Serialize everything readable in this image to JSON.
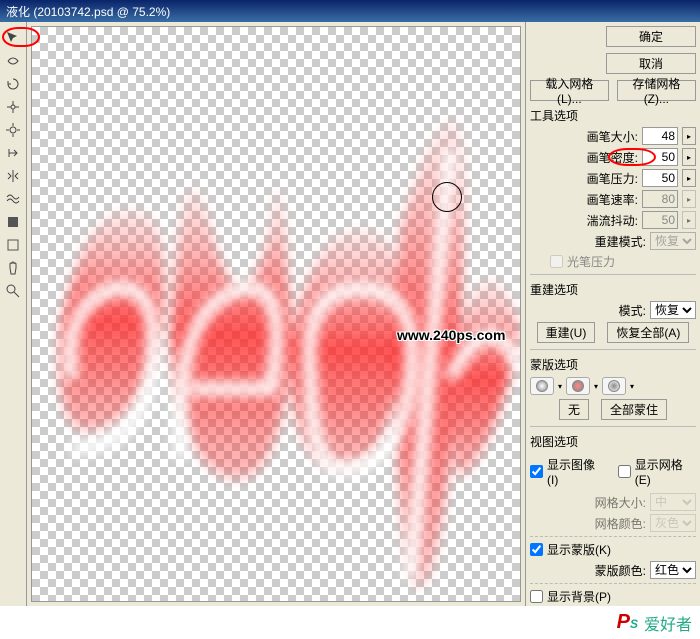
{
  "titlebar": "液化 (20103742.psd @ 75.2%)",
  "btn_ok": "确定",
  "btn_cancel": "取消",
  "btn_load": "载入网格(L)...",
  "btn_save": "存储网格(Z)...",
  "section_tool": "工具选项",
  "brush_size_label": "画笔大小:",
  "brush_size": "48",
  "brush_density_label": "画笔密度:",
  "brush_density": "50",
  "brush_pressure_label": "画笔压力:",
  "brush_pressure": "50",
  "brush_rate_label": "画笔速率:",
  "brush_rate": "80",
  "turb_jitter_label": "湍流抖动:",
  "turb_jitter": "50",
  "rebuild_mode_label": "重建模式:",
  "rebuild_mode": "恢复",
  "pen_pressure_label": "光笔压力",
  "section_rebuild": "重建选项",
  "mode_label": "模式:",
  "mode_value": "恢复",
  "btn_rebuild": "重建(U)",
  "btn_restore_all": "恢复全部(A)",
  "section_mask": "蒙版选项",
  "mask_none": "无",
  "mask_all": "全部蒙住",
  "section_view": "视图选项",
  "show_image_label": "显示图像(I)",
  "show_grid_label": "显示网格(E)",
  "grid_size_label": "网格大小:",
  "grid_size": "中",
  "grid_color_label": "网格颜色:",
  "grid_color": "灰色",
  "show_mask_label": "显示蒙版(K)",
  "mask_color_label": "蒙版颜色:",
  "mask_color": "红色",
  "show_bg_label": "显示背景(P)",
  "watermark": "www.240ps.com",
  "bottom_wm": "爱好者"
}
